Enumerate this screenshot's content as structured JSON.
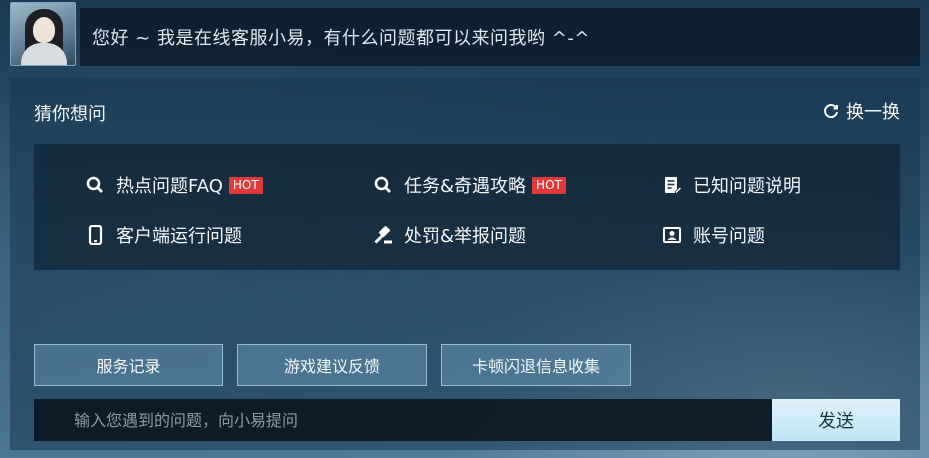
{
  "header": {
    "greeting": "您好 ~ 我是在线客服小易，有什么问题都可以来问我哟 ^-^"
  },
  "panel": {
    "title": "猜你想问",
    "refresh_label": "换一换",
    "hot_badge": "HOT",
    "faq_items": [
      {
        "label": "热点问题FAQ",
        "icon": "search-icon",
        "hot": true
      },
      {
        "label": "任务&奇遇攻略",
        "icon": "search-icon",
        "hot": true
      },
      {
        "label": "已知问题说明",
        "icon": "document-edit-icon",
        "hot": false
      },
      {
        "label": "客户端运行问题",
        "icon": "phone-icon",
        "hot": false
      },
      {
        "label": "处罚&举报问题",
        "icon": "gavel-icon",
        "hot": false
      },
      {
        "label": "账号问题",
        "icon": "account-card-icon",
        "hot": false
      }
    ]
  },
  "actions": {
    "service_record": "服务记录",
    "feedback": "游戏建议反馈",
    "lag_report": "卡顿闪退信息收集"
  },
  "input": {
    "placeholder": "输入您遇到的问题，向小易提问",
    "value": "",
    "send_label": "发送"
  },
  "colors": {
    "hot_badge": "#e23a3a",
    "send_button": "#bfe4f4",
    "panel_bg": "#19374e"
  }
}
